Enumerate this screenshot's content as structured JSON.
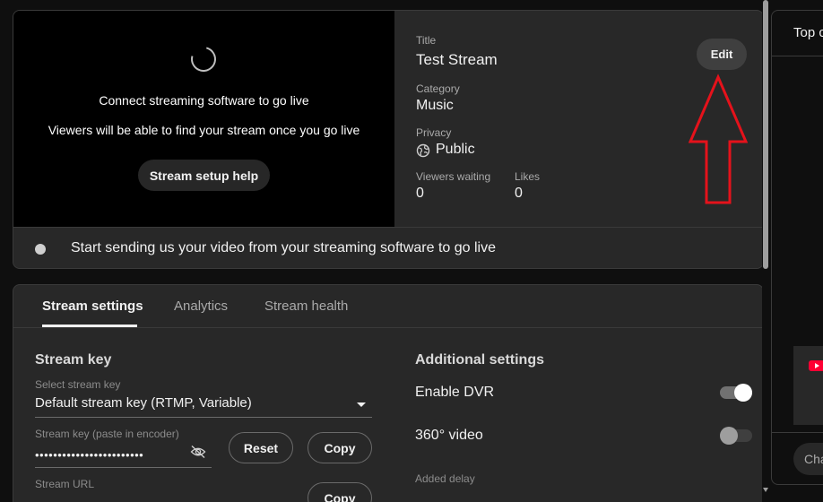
{
  "preview": {
    "line1": "Connect streaming software to go live",
    "line2": "Viewers will be able to find your stream once you go live",
    "help_button": "Stream setup help"
  },
  "info": {
    "title_label": "Title",
    "title_value": "Test Stream",
    "edit_button": "Edit",
    "category_label": "Category",
    "category_value": "Music",
    "privacy_label": "Privacy",
    "privacy_value": "Public",
    "viewers_label": "Viewers waiting",
    "viewers_value": "0",
    "likes_label": "Likes",
    "likes_value": "0"
  },
  "status": {
    "text": "Start sending us your video from your streaming software to go live"
  },
  "tabs": [
    {
      "label": "Stream settings",
      "active": true
    },
    {
      "label": "Analytics",
      "active": false
    },
    {
      "label": "Stream health",
      "active": false
    }
  ],
  "stream_key": {
    "section_title": "Stream key",
    "select_label": "Select stream key",
    "select_value": "Default stream key (RTMP, Variable)",
    "key_label": "Stream key (paste in encoder)",
    "key_value": "••••••••••••••••••••••••",
    "reset_button": "Reset",
    "copy_button": "Copy",
    "url_label": "Stream URL",
    "copy_button_2": "Copy"
  },
  "additional": {
    "section_title": "Additional settings",
    "dvr_label": "Enable DVR",
    "dvr_on": true,
    "video360_label": "360° video",
    "video360_on": false,
    "delay_label": "Added delay"
  },
  "chat": {
    "title": "Top c",
    "input_placeholder": "Cha"
  },
  "colors": {
    "annotation_arrow": "#e5121b",
    "youtube_red": "#ff0033"
  }
}
